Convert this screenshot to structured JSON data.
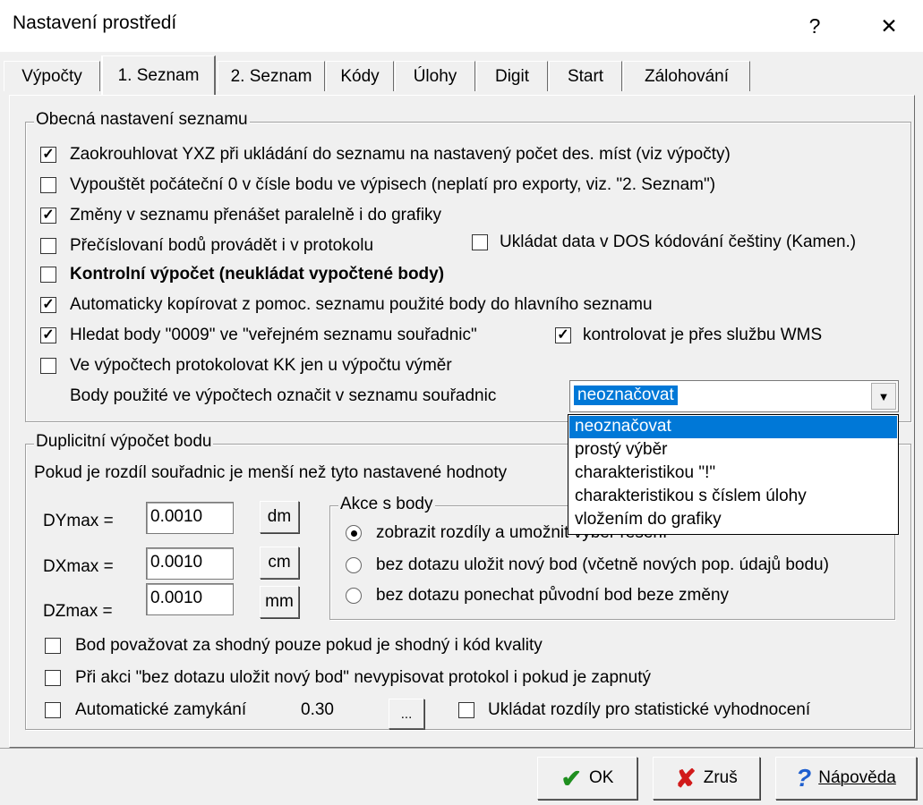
{
  "window": {
    "title": "Nastavení prostředí",
    "help_glyph": "?",
    "close_glyph": "✕"
  },
  "tabs": [
    "Výpočty",
    "1. Seznam",
    "2. Seznam",
    "Kódy",
    "Úlohy",
    "Digit",
    "Start",
    "Zálohování"
  ],
  "general": {
    "legend": "Obecná nastavení seznamu",
    "items": [
      {
        "label": "Zaokrouhlovat YXZ při ukládání do seznamu na nastavený počet des. míst (viz výpočty)",
        "checked": true
      },
      {
        "label": "Vypouštět počáteční 0 v čísle bodu ve výpisech (neplatí pro exporty, viz. \"2. Seznam\")",
        "checked": false
      },
      {
        "label": "Změny v seznamu přenášet paralelně i do grafiky",
        "checked": true
      },
      {
        "label": "Přečíslovaní bodů provádět i v protokolu",
        "checked": false
      },
      {
        "label": "Ukládat data v DOS kódování češtiny (Kamen.)",
        "checked": false
      },
      {
        "label": "Kontrolní výpočet (neukládat vypočtené body)",
        "checked": false
      },
      {
        "label": "Automaticky kopírovat z pomoc. seznamu použité body do hlavního seznamu",
        "checked": true
      },
      {
        "label": "Hledat body \"0009\" ve \"veřejném seznamu souřadnic\"",
        "checked": true
      },
      {
        "label": "kontrolovat je přes službu WMS",
        "checked": true
      },
      {
        "label": "Ve výpočtech protokolovat KK jen u výpočtu výměr",
        "checked": false
      }
    ],
    "mark_label": "Body použité ve výpočtech označit v seznamu souřadnic",
    "mark_value": "neoznačovat",
    "mark_options": [
      "neoznačovat",
      "prostý výběr",
      "charakteristikou \"!\"",
      "charakteristikou s číslem úlohy",
      "vložením do grafiky"
    ]
  },
  "duplicate": {
    "legend": "Duplicitní výpočet bodu",
    "intro": "Pokud je rozdíl souřadnic je menší než tyto nastavené hodnoty",
    "fields": [
      {
        "label": "DYmax =",
        "value": "0.0010",
        "unit": "dm"
      },
      {
        "label": "DXmax =",
        "value": "0.0010",
        "unit": "cm"
      },
      {
        "label": "DZmax =",
        "value": "0.0010",
        "unit": "mm"
      }
    ],
    "actions": {
      "legend": "Akce s body",
      "options": [
        {
          "label": "zobrazit rozdíly a umožnit výběr řešení",
          "selected": true
        },
        {
          "label": "bez dotazu uložit nový bod (včetně nových pop. údajů bodu)",
          "selected": false
        },
        {
          "label": "bez dotazu ponechat původní bod beze změny",
          "selected": false
        }
      ]
    },
    "same_quality": {
      "label": "Bod považovat za shodný pouze pokud je shodný i kód kvality",
      "checked": false
    },
    "no_protocol": {
      "label": "Při akci \"bez dotazu uložit nový bod\" nevypisovat protokol i pokud je zapnutý",
      "checked": false
    },
    "auto_lock": {
      "label": "Automatické zamykání",
      "value": "0.30",
      "button": "...",
      "checked": false
    },
    "stats": {
      "label": "Ukládat rozdíly pro statistické vyhodnocení",
      "checked": false
    }
  },
  "buttons": {
    "ok": "OK",
    "cancel": "Zruš",
    "help": "Nápověda"
  },
  "colors": {
    "accent": "#0078d7",
    "ok_check": "#1f8f1f",
    "cancel_x": "#d11a1a",
    "help_q": "#1f5fcf"
  }
}
